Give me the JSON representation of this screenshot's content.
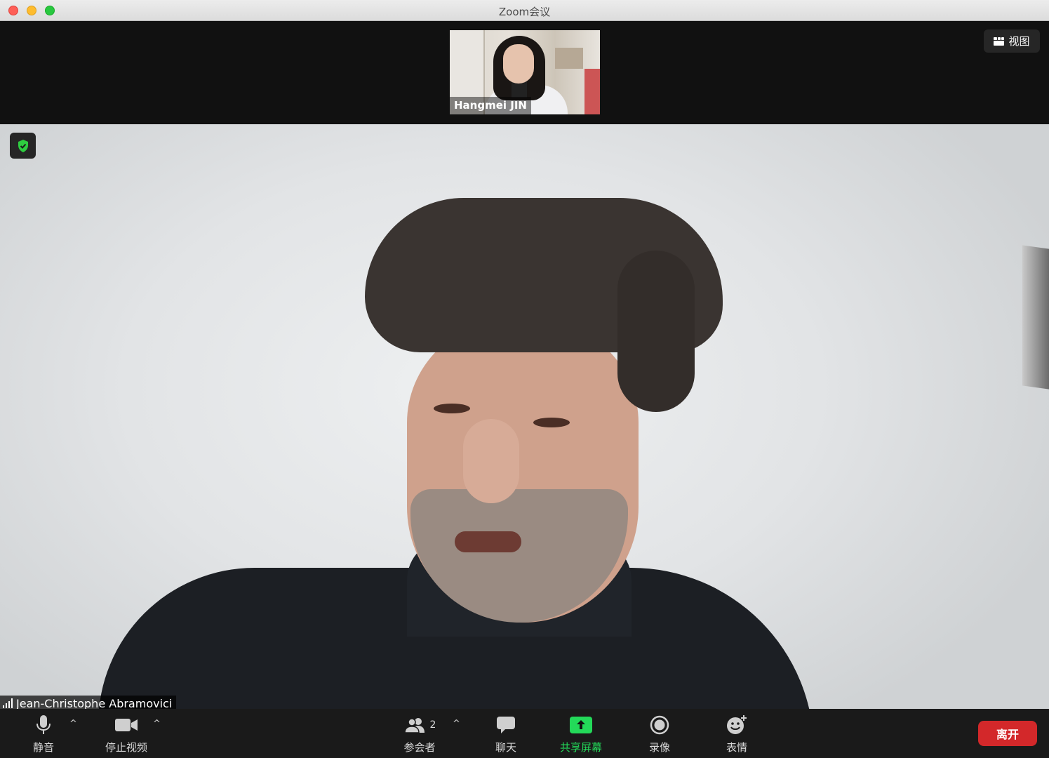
{
  "window": {
    "title": "Zoom会议"
  },
  "top_bar": {
    "view_button": "视图"
  },
  "participants_strip": [
    {
      "name": "Hangmei JIN"
    }
  ],
  "main_video": {
    "speaker_name": "Jean-Christophe Abramovici"
  },
  "toolbar": {
    "mute": "静音",
    "stop_video": "停止视频",
    "participants": "参会者",
    "participants_count": "2",
    "chat": "聊天",
    "share_screen": "共享屏幕",
    "record": "录像",
    "reactions": "表情",
    "leave": "离开"
  },
  "colors": {
    "share_green": "#23d959",
    "leave_red": "#d3282a",
    "shield_green": "#2ecc40"
  }
}
